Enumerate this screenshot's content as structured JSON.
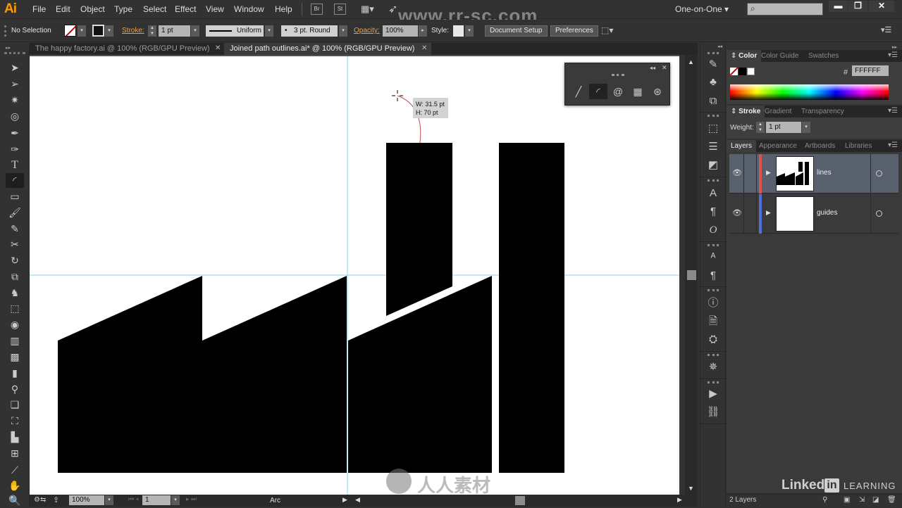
{
  "app": {
    "logo": "Ai",
    "menu": [
      "File",
      "Edit",
      "Object",
      "Type",
      "Select",
      "Effect",
      "View",
      "Window",
      "Help"
    ],
    "bridge_label": "Br",
    "stock_label": "St",
    "workspace": "One-on-One",
    "search_placeholder": "",
    "watermark_url": "www.rr-sc.com"
  },
  "control_bar": {
    "selection": "No Selection",
    "stroke_label": "Stroke:",
    "stroke_weight": "1 pt",
    "stroke_profile": "Uniform",
    "brush": "3 pt. Round",
    "opacity_label": "Opacity:",
    "opacity": "100%",
    "style_label": "Style:",
    "document_setup": "Document Setup",
    "preferences": "Preferences"
  },
  "tabs": [
    {
      "label": "The happy factory.ai @ 100% (RGB/GPU Preview)",
      "active": false
    },
    {
      "label": "Joined path outlines.ai* @ 100% (RGB/GPU Preview)",
      "active": true
    }
  ],
  "tools": [
    "selection-tool",
    "direct-selection-tool",
    "magic-wand-tool",
    "lasso-tool",
    "pen-tool",
    "curvature-tool",
    "type-tool",
    "arc-tool",
    "rectangle-tool",
    "paintbrush-tool",
    "pencil-tool",
    "scissors-tool",
    "rotate-tool",
    "scale-tool",
    "puppet-warp-tool",
    "free-transform-tool",
    "shape-builder-tool",
    "perspective-grid-tool",
    "mesh-tool",
    "gradient-tool",
    "eyedropper-tool",
    "blend-tool",
    "symbol-sprayer-tool",
    "column-graph-tool",
    "artboard-tool",
    "slice-tool",
    "hand-tool",
    "zoom-tool"
  ],
  "selected_tool": "arc-tool",
  "canvas": {
    "tooltip_w": "W: 31.5 pt",
    "tooltip_h": "H: 70 pt"
  },
  "arc_panel": {
    "tools": [
      "line-segment-tool",
      "arc-tool",
      "spiral-tool",
      "rectangular-grid-tool",
      "polar-grid-tool"
    ],
    "selected": "arc-tool"
  },
  "color_panel": {
    "tabs": [
      "Color",
      "Color Guide",
      "Swatches"
    ],
    "hex_label": "#",
    "hex": "FFFFFF"
  },
  "stroke_panel": {
    "tabs": [
      "Stroke",
      "Gradient",
      "Transparency"
    ],
    "weight_label": "Weight:",
    "weight": "1 pt"
  },
  "layers_panel": {
    "tabs": [
      "Layers",
      "Appearance",
      "Artboards",
      "Libraries"
    ],
    "layers": [
      {
        "name": "lines",
        "color": "#d9534f",
        "selected": true
      },
      {
        "name": "guides",
        "color": "#4f6fd9",
        "selected": false
      }
    ],
    "count": "2 Layers"
  },
  "status_bar": {
    "zoom": "100%",
    "artboard": "1",
    "tool_name": "Arc"
  },
  "branding": {
    "linkedin": "Linked",
    "in": "in",
    "learning": "LEARNING"
  }
}
